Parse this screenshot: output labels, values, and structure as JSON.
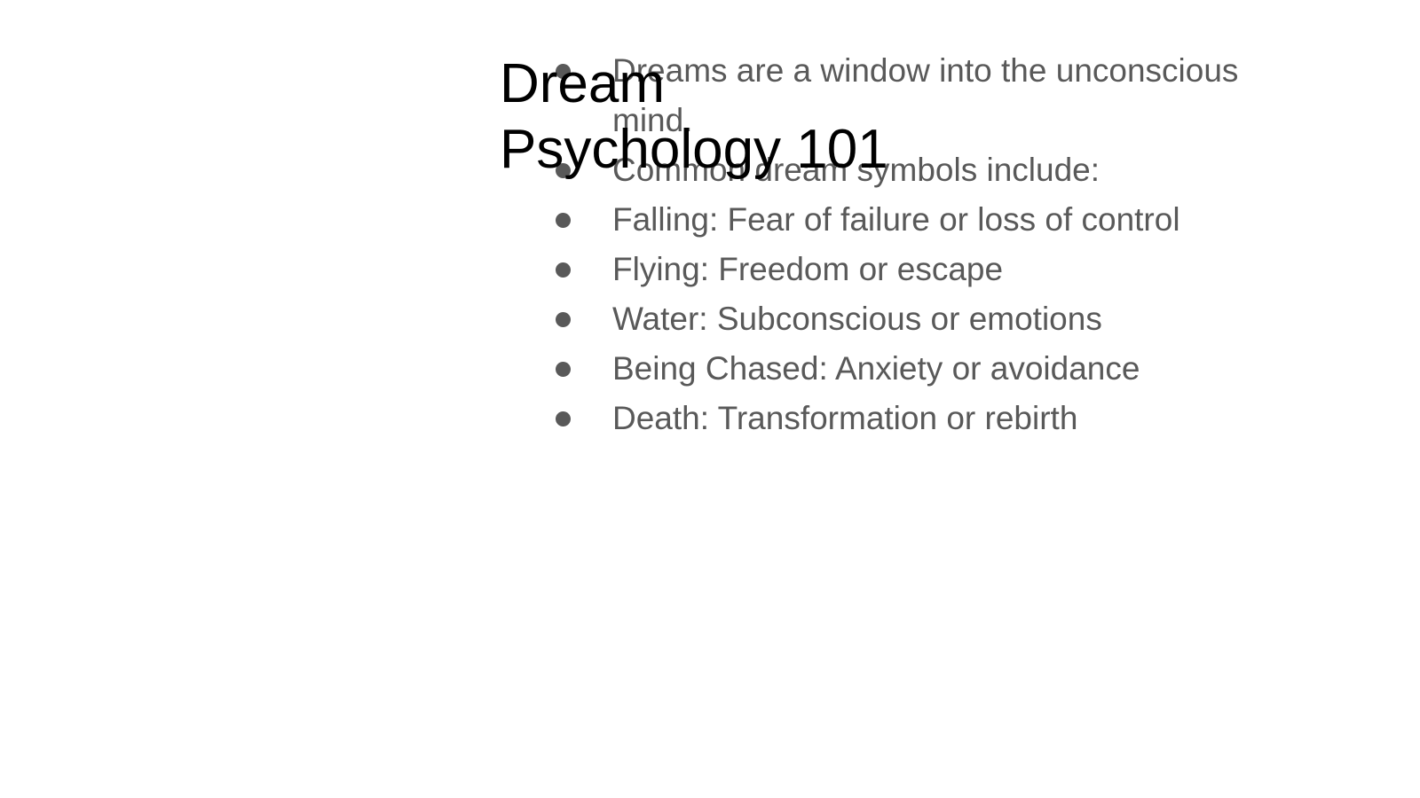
{
  "slide": {
    "title_lines": [
      "Dream",
      "Psychology 101"
    ],
    "bullets": [
      "Dreams are a window into the unconscious mind.",
      "Common dream symbols include:",
      "Falling: Fear of failure or loss of control",
      "Flying: Freedom or escape",
      "Water: Subconscious or emotions",
      "Being Chased: Anxiety or avoidance",
      "Death: Transformation or rebirth"
    ],
    "colors": {
      "title": "#000000",
      "body": "#595959",
      "background": "#ffffff"
    }
  }
}
